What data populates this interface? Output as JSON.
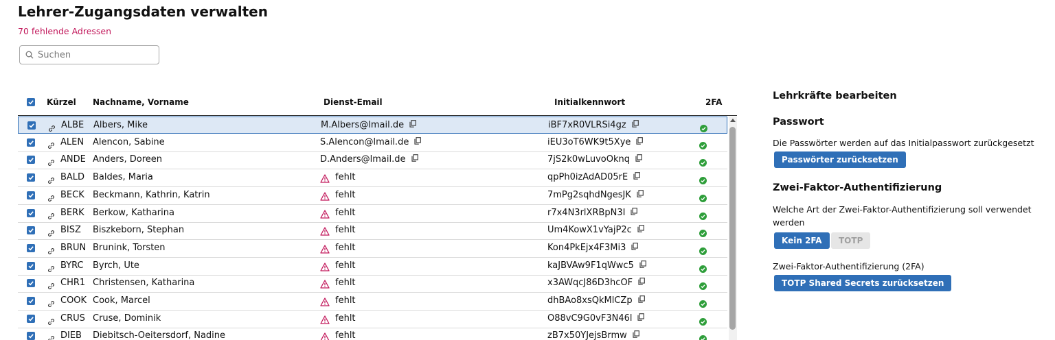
{
  "page": {
    "title": "Lehrer-Zugangsdaten verwalten",
    "missing_count": "70 fehlende Adressen"
  },
  "search": {
    "placeholder": "Suchen"
  },
  "table": {
    "headers": {
      "kuerzel": "Kürzel",
      "name": "Nachname, Vorname",
      "email": "Dienst-Email",
      "password": "Initialkennwort",
      "twofa": "2FA"
    },
    "missing_label": "fehlt",
    "rows": [
      {
        "kuerzel": "ALBE",
        "name": "Albers, Mike",
        "email": "M.Albers@lmail.de",
        "password": "iBF7xR0VLRSi4gz",
        "selected": true
      },
      {
        "kuerzel": "ALEN",
        "name": "Alencon, Sabine",
        "email": "S.Alencon@lmail.de",
        "password": "iEU3oT6WK9t5Xye",
        "selected": true
      },
      {
        "kuerzel": "ANDE",
        "name": "Anders, Doreen",
        "email": "D.Anders@lmail.de",
        "password": "7jS2k0wLuvoOknq",
        "selected": true
      },
      {
        "kuerzel": "BALD",
        "name": "Baldes, Maria",
        "email": "",
        "password": "qpPh0izAdAD05rE",
        "selected": true
      },
      {
        "kuerzel": "BECK",
        "name": "Beckmann, Kathrin, Katrin",
        "email": "",
        "password": "7mPg2sqhdNgesJK",
        "selected": true
      },
      {
        "kuerzel": "BERK",
        "name": "Berkow, Katharina",
        "email": "",
        "password": "r7x4N3rlXRBpN3I",
        "selected": true
      },
      {
        "kuerzel": "BISZ",
        "name": "Biszkeborn, Stephan",
        "email": "",
        "password": "Um4KowX1vYajP2c",
        "selected": true
      },
      {
        "kuerzel": "BRUN",
        "name": "Brunink, Torsten",
        "email": "",
        "password": "Kon4PkEjx4F3Mi3",
        "selected": true
      },
      {
        "kuerzel": "BYRC",
        "name": "Byrch, Ute",
        "email": "",
        "password": "kaJBVAw9F1qWwc5",
        "selected": true
      },
      {
        "kuerzel": "CHR1",
        "name": "Christensen, Katharina",
        "email": "",
        "password": "x3AWqcJ86D3hcOF",
        "selected": true
      },
      {
        "kuerzel": "COOK",
        "name": "Cook, Marcel",
        "email": "",
        "password": "dhBAo8xsQkMlCZp",
        "selected": true
      },
      {
        "kuerzel": "CRUS",
        "name": "Cruse, Dominik",
        "email": "",
        "password": "O88vC9G0vF3N46l",
        "selected": true
      },
      {
        "kuerzel": "DIEB",
        "name": "Diebitsch-Oeitersdorf, Nadine",
        "email": "",
        "password": "zB7x50YJejsBrmw",
        "selected": true
      }
    ]
  },
  "panel": {
    "title": "Lehrkräfte bearbeiten",
    "password": {
      "heading": "Passwort",
      "text": "Die Passwörter werden auf das Initialpasswort zurückgesetzt",
      "button": "Passwörter zurücksetzen"
    },
    "twofa": {
      "heading": "Zwei-Faktor-Authentifizierung",
      "text": "Welche Art der Zwei-Faktor-Authentifizierung soll verwendet werden",
      "option_none": "Kein 2FA",
      "option_totp": "TOTP",
      "reset_label": "Zwei-Faktor-Authentifizierung (2FA)",
      "reset_button": "TOTP Shared Secrets zurücksetzen"
    }
  },
  "colors": {
    "accent": "#2f6fb7",
    "missing": "#c2185b",
    "ok": "#2e9e3a",
    "warning": "#c2185b"
  }
}
